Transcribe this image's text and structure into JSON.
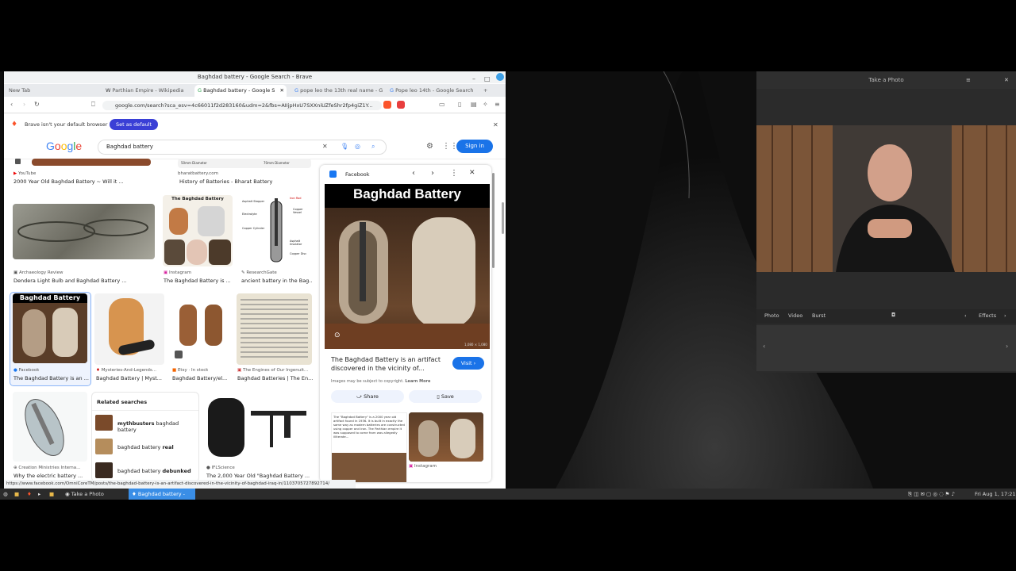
{
  "browser": {
    "window_title": "Baghdad battery - Google Search - Brave",
    "tabs": [
      {
        "label": "New Tab"
      },
      {
        "label": "Parthian Empire - Wikipedia"
      },
      {
        "label": "Baghdad battery - Google S"
      },
      {
        "label": "pope leo the 13th real name - G"
      },
      {
        "label": "Pope leo 14th - Google Search"
      }
    ],
    "url": "google.com/search?sca_esv=4c66011f2d283160&udm=2&fbs=AIIjpHxU7SXXniUZfeShr2fp4giZ1Y...",
    "notice_text": "Brave isn't your default browser",
    "set_default_label": "Set as default",
    "status_url": "https://www.facebook.com/OmniCoreTM/posts/the-baghdad-battery-is-an-artifact-discovered-in-the-vicinity-of-baghdad-iraq-in/1103705727892714/"
  },
  "google": {
    "logo": "Google",
    "query": "Baghdad battery",
    "sign_in_label": "Sign in"
  },
  "results": {
    "row0": [
      {
        "source": "YouTube",
        "title": "2000 Year Old Baghdad Battery ~ Will it ..."
      },
      {
        "source": "bharatbattery.com",
        "title": "History of Batteries - Bharat Battery"
      }
    ],
    "row0_diagram_labels": {
      "left": "50mm Diameter",
      "right": "70mm Diameter"
    },
    "row1": [
      {
        "source": "Archaeology Review",
        "title": "Dendera Light Bulb and Baghdad Battery ..."
      },
      {
        "source": "Instagram",
        "title": "The Baghdad Battery is ..."
      },
      {
        "source": "ResearchGate",
        "title": "ancient battery in the Bag..."
      }
    ],
    "row1_thumb_heading": "The Baghdad Battery",
    "diagram_labels": [
      "Asphalt Stopper",
      "Iron Rod",
      "Copper Vessel",
      "Electrolyte",
      "Copper Cylinder",
      "Asphalt Insulator",
      "Copper Disc"
    ],
    "row2": [
      {
        "source": "Facebook",
        "title": "The Baghdad Battery is an ..."
      },
      {
        "source": "Mysteries-And-Legends...",
        "title": "Baghdad Battery | Myst..."
      },
      {
        "source": "Etsy · In stock",
        "title": "Baghdad Battery/el..."
      },
      {
        "source": "The Engines of Our Ingenuit...",
        "title": "Baghdad Batteries | The En..."
      }
    ],
    "row2_thumb_heading": "Baghdad Battery",
    "row3": [
      {
        "source": "Creation Ministries Interna...",
        "title": "Why the electric battery ..."
      },
      {
        "source": "IFLScience",
        "title": "The 2,000 Year Old \"Baghdad Battery ..."
      }
    ],
    "related_title": "Related searches",
    "related": [
      {
        "bold": "mythbusters",
        "rest": " baghdad battery"
      },
      {
        "bold": "",
        "rest": "baghdad battery ",
        "tail": "real"
      },
      {
        "bold": "",
        "rest": "baghdad battery ",
        "tail": "debunked"
      }
    ]
  },
  "panel": {
    "source": "Facebook",
    "image_heading": "Baghdad Battery",
    "image_size": "1,080 × 1,080",
    "title": "The Baghdad Battery is an artifact discovered in the vicinity of...",
    "visit_label": "Visit ›",
    "copyright": "Images may be subject to copyright.",
    "learn_more": "Learn More",
    "share_label": "Share",
    "save_label": "Save",
    "related_text": "The \"Baghdad Battery\" is a 2000 year old artifact found in 1936. It is built in exactly the same way as modern batteries are constructed using copper and iron. The Parthian empire it was supposed to come from was allegedly illiterate...",
    "related_source": "Instagram"
  },
  "camera": {
    "title": "Take a Photo",
    "modes": [
      "Photo",
      "Video",
      "Burst"
    ],
    "effects_label": "Effects"
  },
  "taskbar": {
    "items": [
      {
        "label": "Take a Photo"
      },
      {
        "label": "Baghdad battery - G..."
      }
    ],
    "clock": "Fri Aug 1, 17:21"
  },
  "colors": {
    "accent": "#1a73e8",
    "brave_default": "#3a3fd6",
    "taskbar": "#2b2b2b"
  }
}
